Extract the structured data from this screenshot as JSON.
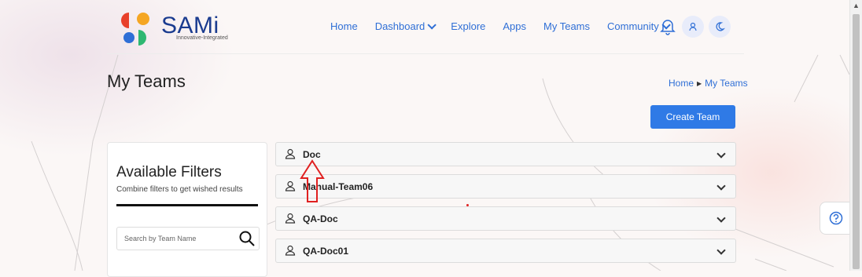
{
  "colors": {
    "accent": "#2f7ae6",
    "link": "#2f6fd6",
    "annotation": "#e02020"
  },
  "brand": {
    "name": "SAMi",
    "tagline": "Innovative-Integrated"
  },
  "nav": {
    "items": [
      {
        "label": "Home",
        "dropdown": false
      },
      {
        "label": "Dashboard",
        "dropdown": true
      },
      {
        "label": "Explore",
        "dropdown": false
      },
      {
        "label": "Apps",
        "dropdown": false
      },
      {
        "label": "My Teams",
        "dropdown": false
      },
      {
        "label": "Community",
        "dropdown": true
      }
    ],
    "icons": [
      "bell-icon",
      "user-icon",
      "moon-icon"
    ]
  },
  "page": {
    "title": "My Teams",
    "breadcrumb": [
      "Home",
      "My Teams"
    ],
    "create_button": "Create Team"
  },
  "filters": {
    "heading": "Available Filters",
    "subheading": "Combine filters to get wished results",
    "search_placeholder": "Search by Team Name"
  },
  "teams": [
    "Doc",
    "Manual-Team06",
    "QA-Doc",
    "QA-Doc01"
  ]
}
